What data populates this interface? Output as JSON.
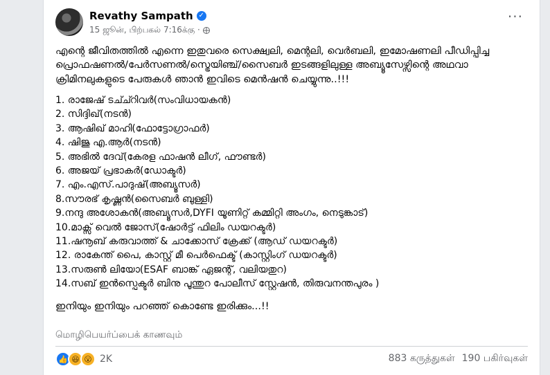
{
  "post": {
    "author": "Revathy Sampath",
    "timestamp": "15 ஜூன், பிற்பகல் 7:16க்கு ·",
    "intro": "എന്റെ ജീവിതത്തിൽ എന്നെ ഇതുവരെ സെക്ഷ്വലി, മെന്റലി, വെർബലി, ഇമോഷണലി പീഡിപ്പിച്ച പ്രൊഫഷണൽ/പേർസണൽ/സ്ട്രെയിഞ്ച്/സൈബർ ഇടങ്ങളിലുള്ള അബ്യൂസേഴ്സിന്റെ അഥവാ ക്രിമിനലുകളുടെ പേരുകൾ ഞാൻ ഇവിടെ മെൻഷൻ ചെയ്യുന്നു..!!!",
    "list": [
      "1. രാജേഷ് ടച്ച്റിവർ(സംവിധായകൻ)",
      "2. സിദ്ദിഖ്(നടൻ)",
      "3. ആഷിഖ് മാഹി(ഫോട്ടോഗ്രാഫർ)",
      "4. ഷിജു എ.ആർ(നടൻ)",
      "5. അഭിൽ ദേവ്(കേരള ഫാഷൻ ലീഗ്, ഫൗണ്ടർ)",
      "6. അജയ് പ്രഭാകർ(ഡോക്ടർ)",
      "7. എം.എസ്.പാദുഷ്(അബ്യൂസർ)",
      "8.സൗരഭ് കൃഷ്ണൻ(സൈബർ ബുള്ളി)",
      "9.നന്ദു അശോകൻ(അബ്യൂസർ,DYFI യൂണിറ്റ് കമ്മിറ്റി അംഗം, നെടുങ്കാട്)",
      "10.മാക്സ് വെൽ ജോസ്(ഷോർട്ട് ഫിലിം ഡയറക്ടർ)",
      "11.ഷനൂബ് കരുവാത്ത് & ചാക്കോസ് ക്രേക്ക് (ആഡ് ഡയറക്ടർ)",
      "12. രാകേന്ത് പൈ, കാസ്റ്റ് മീ പെർഫെക്ട് (കാസ്റ്റിംഗ് ഡയറക്ടർ)",
      "13.സരുൺ ലിയോ(ESAF ബാങ്ക് ഏജന്റ്, വലിയതുറ)",
      "14.സബ് ഇൻസ്പെക്ടർ ബിനു പൂന്തുറ പോലീസ് സ്റ്റേഷൻ, തിരുവനന്തപുരം )"
    ],
    "closing": "ഇനിയും ഇനിയും പറഞ്ഞ് കൊണ്ടേ ഇരിക്കും...!!",
    "see_translation": "மொழிபெயர்ப்பைக் காணவும்"
  },
  "engagement": {
    "reaction_count": "2K",
    "comments": "883 கருத்துகள்",
    "shares": "190 பகிர்வுகள்",
    "reactions": [
      "like-icon",
      "haha-icon",
      "wow-icon"
    ]
  },
  "colors": {
    "accent": "#1877f2",
    "muted": "#65676b",
    "text": "#050505"
  }
}
